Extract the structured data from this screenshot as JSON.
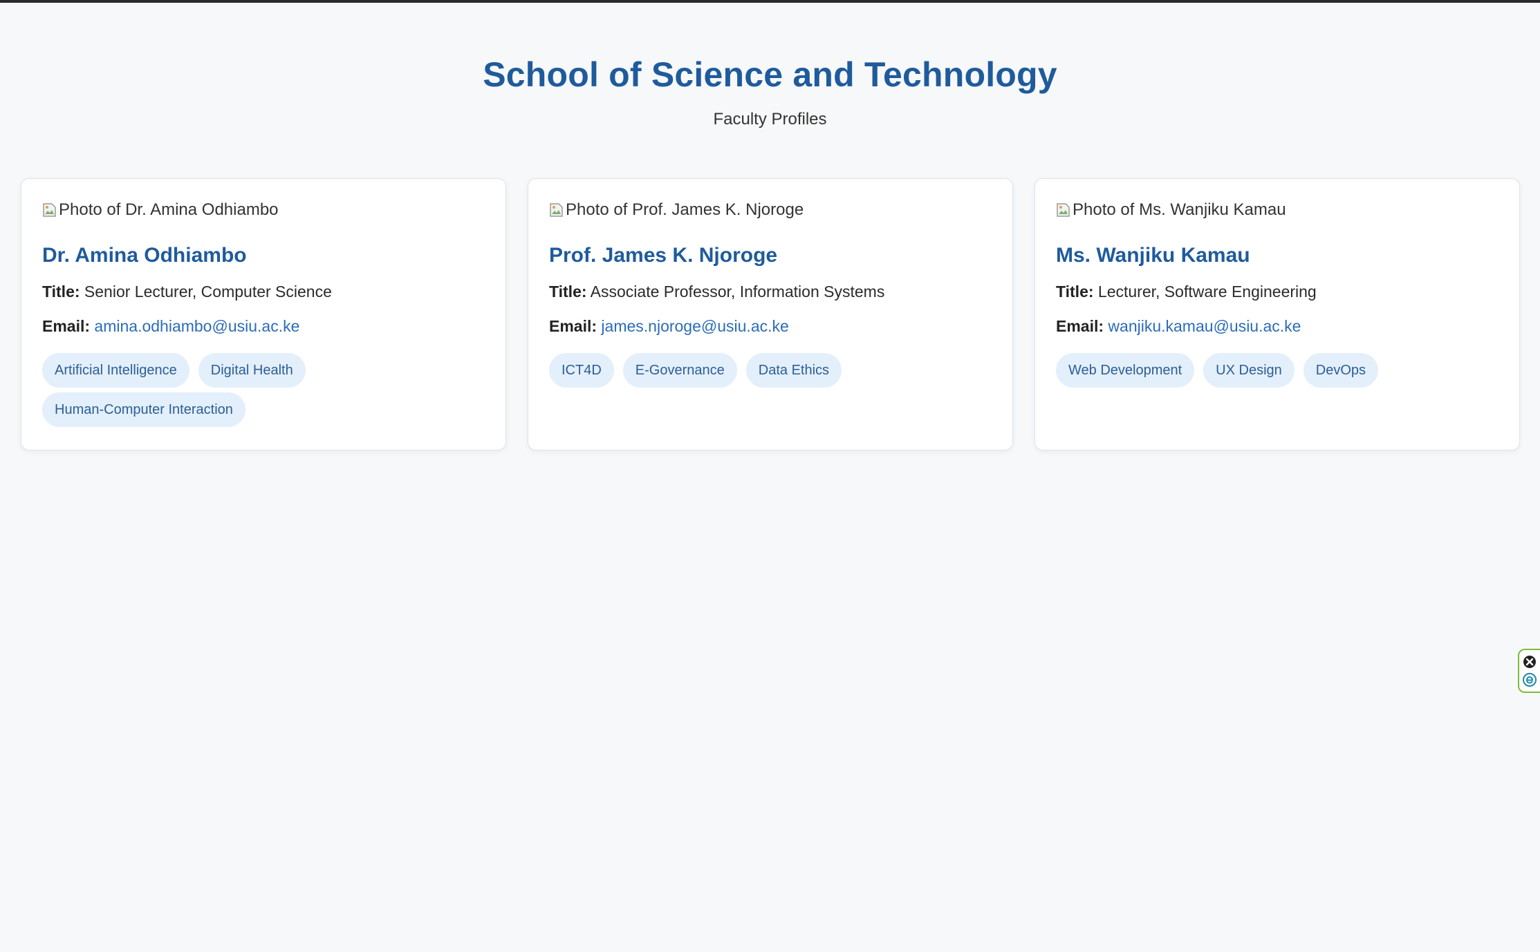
{
  "header": {
    "title": "School of Science and Technology",
    "subtitle": "Faculty Profiles"
  },
  "labels": {
    "title_label": "Title:",
    "email_label": "Email:"
  },
  "faculty": [
    {
      "photo_alt": "Photo of Dr. Amina Odhiambo",
      "name": "Dr. Amina Odhiambo",
      "title": "Senior Lecturer, Computer Science",
      "email": "amina.odhiambo@usiu.ac.ke",
      "tags": [
        "Artificial Intelligence",
        "Digital Health",
        "Human-Computer Interaction"
      ]
    },
    {
      "photo_alt": "Photo of Prof. James K. Njoroge",
      "name": "Prof. James K. Njoroge",
      "title": "Associate Professor, Information Systems",
      "email": "james.njoroge@usiu.ac.ke",
      "tags": [
        "ICT4D",
        "E-Governance",
        "Data Ethics"
      ]
    },
    {
      "photo_alt": "Photo of Ms. Wanjiku Kamau",
      "name": "Ms. Wanjiku Kamau",
      "title": "Lecturer, Software Engineering",
      "email": "wanjiku.kamau@usiu.ac.ke",
      "tags": [
        "Web Development",
        "UX Design",
        "DevOps"
      ]
    }
  ],
  "side_widget": {
    "icons": [
      "close-icon",
      "extension-e-icon"
    ],
    "accent": "#7dbb3a"
  },
  "colors": {
    "heading": "#1f5b9c",
    "link": "#2b6cb8",
    "tag_bg": "#e3effb",
    "tag_text": "#2c5e95",
    "page_bg": "#f7f8fa"
  }
}
